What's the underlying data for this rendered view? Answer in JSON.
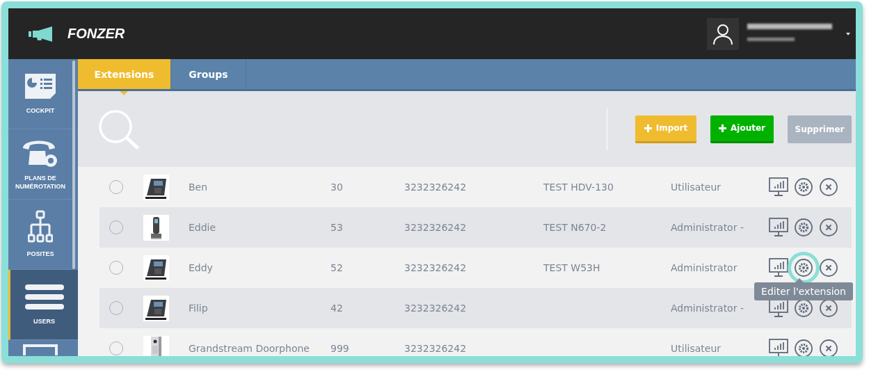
{
  "header": {
    "brand": "FONZER"
  },
  "sidebar": {
    "items": [
      {
        "kind": "cockpit",
        "label": "COCKPIT",
        "selected": false
      },
      {
        "kind": "dialplan",
        "label": "PLANS DE NUMÉROTATION",
        "selected": false
      },
      {
        "kind": "tree",
        "label": "POSITES",
        "selected": false
      },
      {
        "kind": "users",
        "label": "USERS",
        "selected": true
      },
      {
        "kind": "window",
        "selected": false
      }
    ]
  },
  "tabs": [
    {
      "label": "Extensions",
      "selected": true
    },
    {
      "label": "Groups",
      "selected": false
    }
  ],
  "toolbar": {
    "buttons": [
      {
        "kind": "import",
        "label": "Import",
        "disabled": false
      },
      {
        "kind": "add",
        "label": "Ajouter",
        "disabled": false
      },
      {
        "kind": "delete",
        "label": "Supprimer",
        "disabled": true
      }
    ]
  },
  "rows": [
    {
      "name": "Ben",
      "extension": "30",
      "number": "3232326242",
      "device": "TEST HDV-130",
      "role": "Utilisateur",
      "selected": false
    },
    {
      "name": "Eddie",
      "extension": "53",
      "number": "3232326242",
      "device": "TEST N670-2",
      "role": "Administrator -",
      "selected": false
    },
    {
      "name": "Eddy",
      "extension": "52",
      "number": "3232326242",
      "device": "TEST W53H",
      "role": "Administrator",
      "selected": false,
      "edit_highlighted": true,
      "tooltip": "Editer l'extension"
    },
    {
      "name": "Filip",
      "extension": "42",
      "number": "3232326242",
      "role": "Administrator -",
      "selected": false
    },
    {
      "name": "Grandstream Doorphone",
      "extension": "999",
      "number": "3232326242",
      "role": "Utilisateur",
      "selected": false
    }
  ]
}
